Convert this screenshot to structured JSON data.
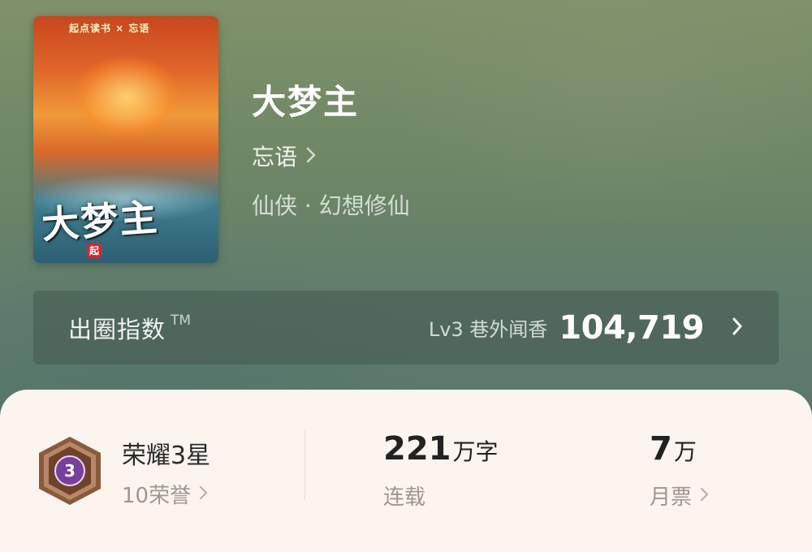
{
  "book": {
    "cover": {
      "top_line": "起点读书 × 忘语",
      "title": "大梦主",
      "badge": "起"
    },
    "title": "大梦主",
    "author": "忘语",
    "genre": "仙侠 · 幻想修仙"
  },
  "index": {
    "label": "出圈指数",
    "tm": "TM",
    "level": "Lv3 巷外闻香",
    "score": "104,719"
  },
  "stats": {
    "honor": {
      "medal_number": "3",
      "title": "荣耀3星",
      "sub": "10荣誉"
    },
    "words": {
      "number": "221",
      "unit": "万字",
      "label": "连载"
    },
    "votes": {
      "number": "7",
      "unit": "万",
      "label": "月票"
    }
  },
  "colors": {
    "panel_bg": "#fbf4ef",
    "medal_purple": "#7a3e9c",
    "medal_bronze": "#8a5a3c"
  }
}
